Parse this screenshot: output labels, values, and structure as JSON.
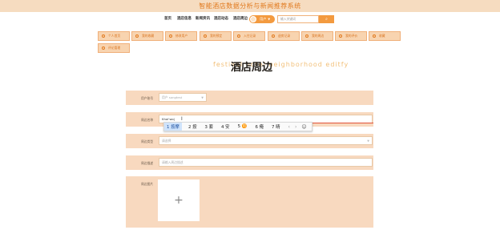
{
  "header": {
    "site_title": "智能酒店数据分析与新闻推荐系统"
  },
  "nav": {
    "items": [
      "首页",
      "酒店信息",
      "新闻资讯",
      "酒店动态",
      "酒店周边"
    ],
    "user_name": "用户",
    "search_placeholder": "输入关键词",
    "search_icon": "search-icon"
  },
  "menu": {
    "items": [
      "个人首页",
      "我的收藏",
      "修改用户",
      "我的预定",
      "入住记录",
      "退房记录",
      "我的周边",
      "我的评价",
      "收藏",
      "评论管理"
    ]
  },
  "page": {
    "bg_title": "festival  hotel  neighborhood  editfy",
    "title": "酒店周边"
  },
  "form": {
    "user_label": "用户账号",
    "user_value": "用户 songtest",
    "name_label": "周边名称",
    "name_value": "Khai'wo|",
    "type_label": "周边类型",
    "type_value": "请选择",
    "desc_label": "周边描述",
    "desc_placeholder": "请输入周边描述",
    "image_label": "周边图片",
    "upload_symbol": "+"
  },
  "ime": {
    "candidates": [
      "1 按摩",
      "2 按",
      "3 套",
      "4 安",
      "5 🉑",
      "6 俺",
      "7 晴"
    ],
    "prev": "‹",
    "next": "›",
    "emoji": "☺"
  },
  "colors": {
    "accent": "#f39a3f",
    "panel": "#f8d9bf",
    "title_bar": "#f6dcc0"
  }
}
